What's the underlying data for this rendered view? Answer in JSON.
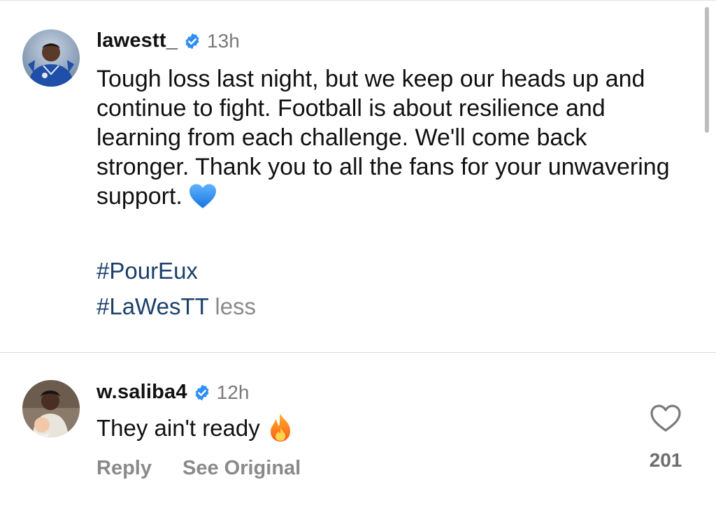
{
  "post": {
    "username": "lawestt_",
    "time": "13h",
    "text": "Tough loss last night, but we keep our heads up and continue to fight. Football is about resilience and learning from each challenge. We'll come back stronger. Thank you to all the fans for your unwavering support.",
    "hashtags": [
      "#PourEux",
      "#LaWesTT"
    ],
    "less_label": "less",
    "emoji": "blue-heart-emoji"
  },
  "comment": {
    "username": "w.saliba4",
    "time": "12h",
    "text": "They ain't ready",
    "emoji": "fire-emoji",
    "reply_label": "Reply",
    "see_original_label": "See Original",
    "like_count": "201"
  },
  "colors": {
    "verified": "#2e8ef3",
    "hashtag": "#1b3f6b",
    "muted": "#8a8a8a"
  }
}
